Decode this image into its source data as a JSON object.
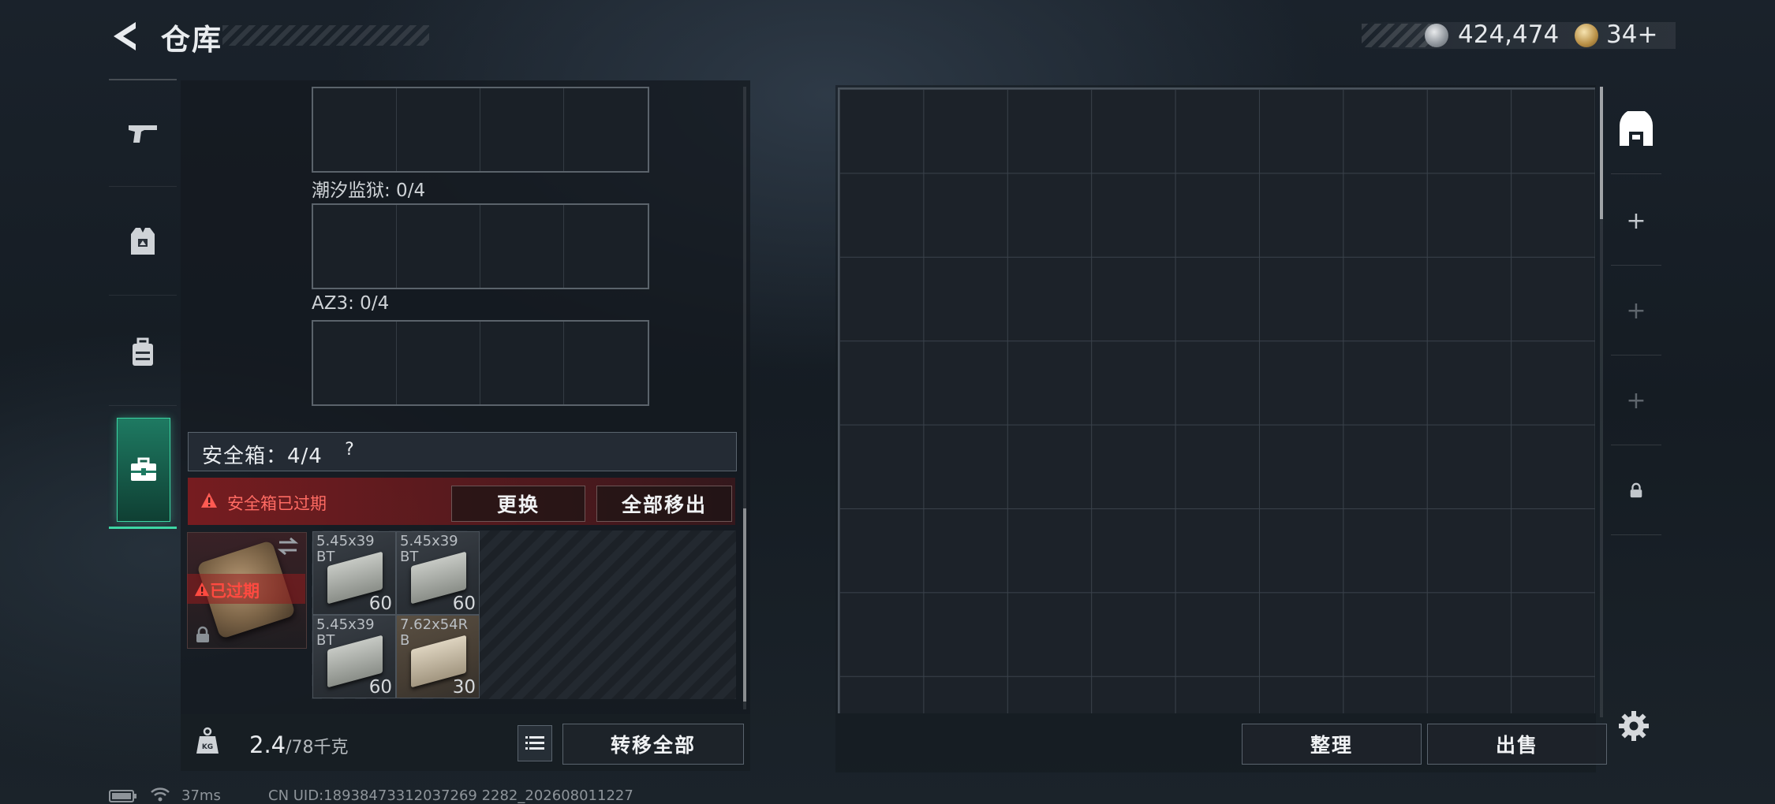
{
  "header": {
    "title": "仓库",
    "currency_silver": "424,474",
    "currency_gold": "34+"
  },
  "sidebar": {
    "tabs": [
      {
        "name": "weapons",
        "icon": "pistol-icon"
      },
      {
        "name": "armor",
        "icon": "vest-icon"
      },
      {
        "name": "backpack",
        "icon": "backpack-icon"
      },
      {
        "name": "safebox",
        "icon": "toolbox-icon",
        "active": true
      }
    ]
  },
  "container": {
    "slot_labels": [
      "潮汐监狱: 0/4",
      "AZ3: 0/4"
    ],
    "safebox_title": "安全箱：4/4",
    "help": "?",
    "alert_text": "安全箱已过期",
    "replace_label": "更换",
    "move_all_label": "全部移出",
    "expired_label": "已过期",
    "ammo": [
      {
        "name": "5.45x39\nBT",
        "count": "60",
        "color": "grey"
      },
      {
        "name": "5.45x39\nBT",
        "count": "60",
        "color": "grey"
      },
      {
        "name": "5.45x39\nBT",
        "count": "60",
        "color": "grey"
      },
      {
        "name": "7.62x54R\nB",
        "count": "30",
        "color": "tan"
      }
    ],
    "weight_value": "2.4",
    "weight_unit": "/78千克",
    "transfer_all_label": "转移全部"
  },
  "stash": {
    "organize_label": "整理",
    "sell_label": "出售"
  },
  "status": {
    "ping": "37ms",
    "uid": "CN UID:18938473312037269 2282_202608011227"
  }
}
